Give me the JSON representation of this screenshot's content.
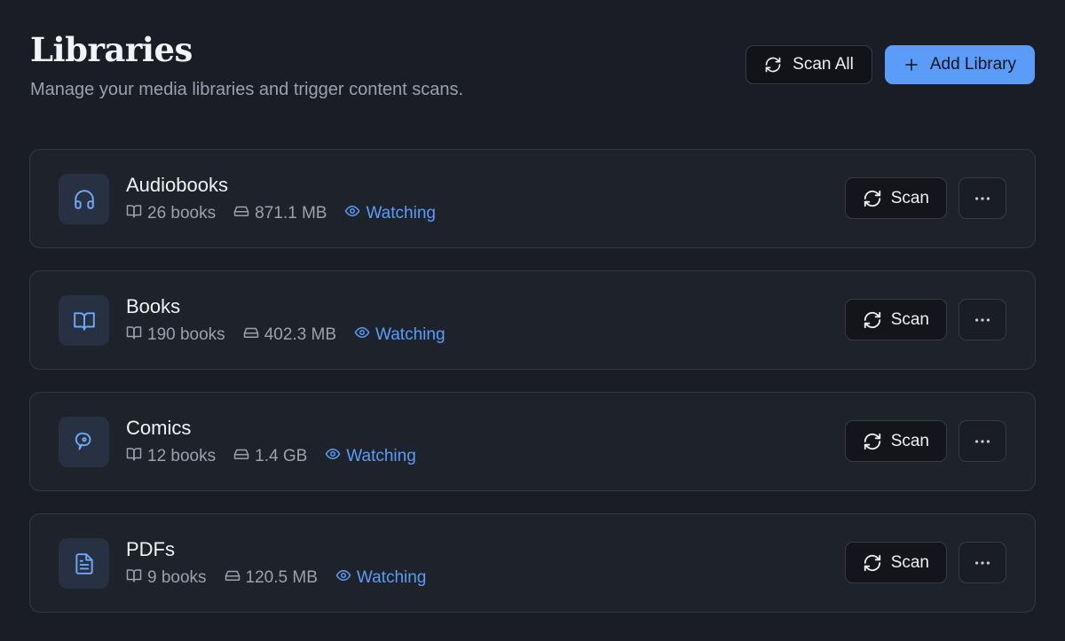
{
  "header": {
    "title": "Libraries",
    "subtitle": "Manage your media libraries and trigger content scans.",
    "scan_all_label": "Scan All",
    "add_library_label": "Add Library"
  },
  "libraries": [
    {
      "name": "Audiobooks",
      "icon": "headphones-icon",
      "books": "26 books",
      "size": "871.1 MB",
      "status": "Watching",
      "scan_label": "Scan"
    },
    {
      "name": "Books",
      "icon": "open-book-icon",
      "books": "190 books",
      "size": "402.3 MB",
      "status": "Watching",
      "scan_label": "Scan"
    },
    {
      "name": "Comics",
      "icon": "speech-bubble-icon",
      "books": "12 books",
      "size": "1.4 GB",
      "status": "Watching",
      "scan_label": "Scan"
    },
    {
      "name": "PDFs",
      "icon": "document-icon",
      "books": "9 books",
      "size": "120.5 MB",
      "status": "Watching",
      "scan_label": "Scan"
    }
  ],
  "colors": {
    "background": "#1a1d25",
    "card": "#1e222b",
    "accent": "#5b9cf8",
    "muted_text": "#9ba1ad"
  }
}
